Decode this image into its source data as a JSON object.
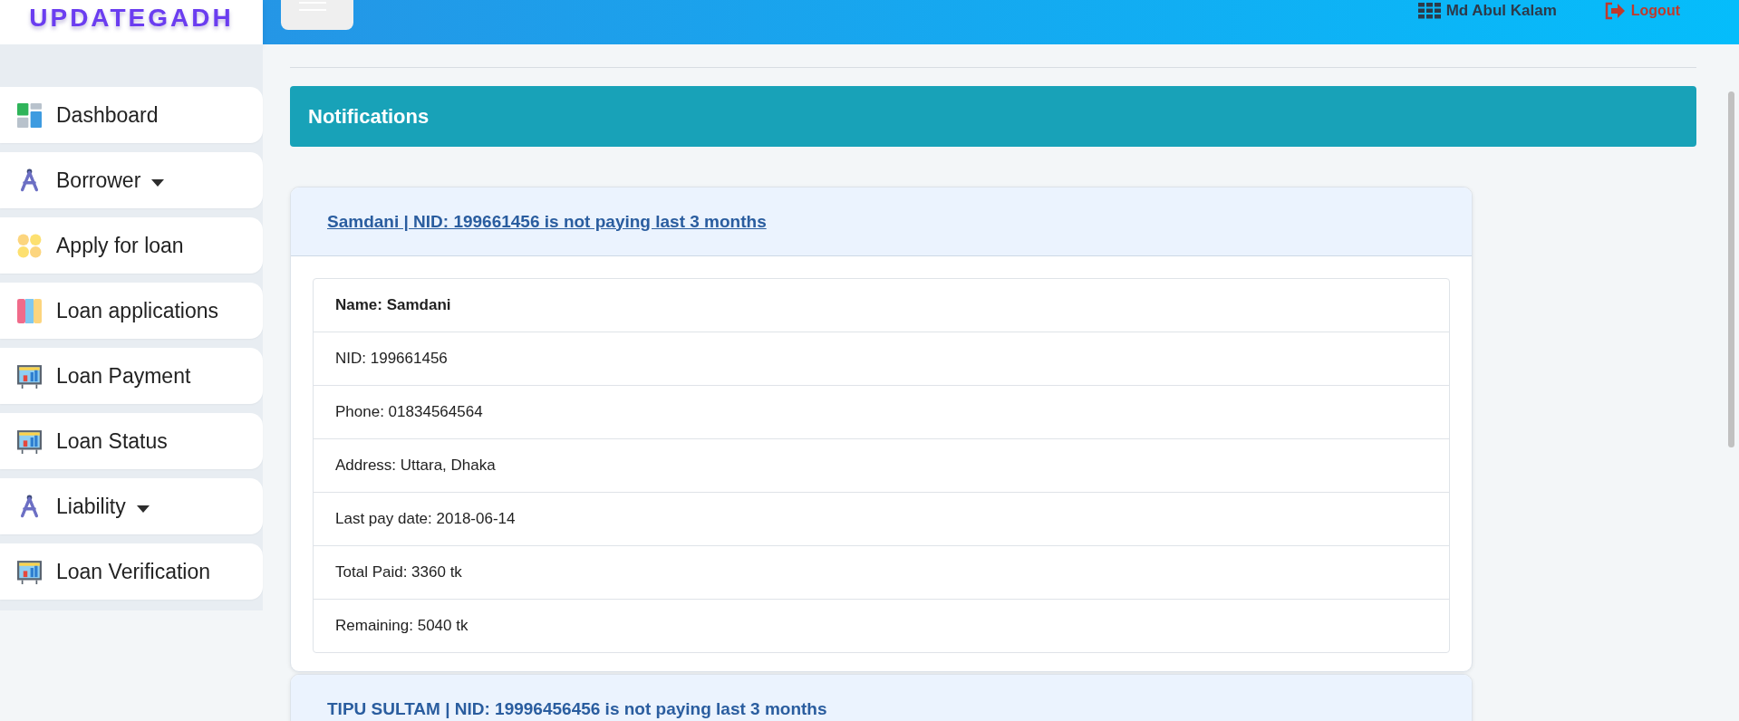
{
  "logo": "UPDATEGADH",
  "header": {
    "user": "Md Abul Kalam",
    "logout": "Logout"
  },
  "sidebar": {
    "items": [
      {
        "label": "Dashboard",
        "kind": "tiles",
        "dropdown": false
      },
      {
        "label": "Borrower",
        "kind": "figure",
        "dropdown": true
      },
      {
        "label": "Apply for loan",
        "kind": "dots",
        "dropdown": false
      },
      {
        "label": "Loan applications",
        "kind": "columns",
        "dropdown": false
      },
      {
        "label": "Loan Payment",
        "kind": "board",
        "dropdown": false
      },
      {
        "label": "Loan Status",
        "kind": "board",
        "dropdown": false
      },
      {
        "label": "Liability",
        "kind": "figure",
        "dropdown": true
      },
      {
        "label": "Loan Verification",
        "kind": "board",
        "dropdown": false
      }
    ]
  },
  "page_title": "Notifications",
  "notifications": [
    {
      "title": "Samdani | NID: 199661456 is not paying last 3 months",
      "link": true,
      "details": [
        {
          "text": "Name: Samdani",
          "kind": "heading"
        },
        {
          "text": "NID: 199661456",
          "kind": "plain"
        },
        {
          "text": "Phone: 01834564564",
          "kind": "plain"
        },
        {
          "text": "Address: Uttara, Dhaka",
          "kind": "plain"
        },
        {
          "text": "Last pay date: 2018-06-14",
          "kind": "plain"
        },
        {
          "text": "Total Paid: 3360 tk",
          "kind": "plain"
        },
        {
          "text": "Remaining: 5040 tk",
          "kind": "plain"
        }
      ]
    },
    {
      "title": "TIPU SULTAM | NID: 19996456456 is not paying last 3 months",
      "link": false
    }
  ]
}
